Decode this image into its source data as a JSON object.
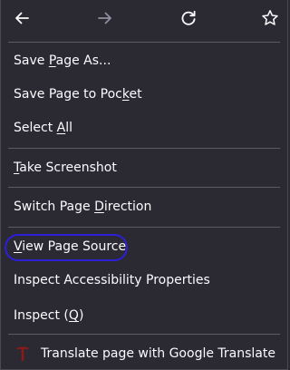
{
  "nav": {
    "back_icon": "arrow-left-icon",
    "forward_icon": "arrow-right-icon",
    "reload_icon": "reload-icon",
    "bookmark_icon": "star-icon",
    "forward_disabled": true
  },
  "menu": {
    "items": [
      {
        "id": "save-page-as",
        "pre": "Save ",
        "key": "P",
        "post": "age As..."
      },
      {
        "id": "save-page-to-pocket",
        "pre": "Save Page to Poc",
        "key": "k",
        "post": "et"
      },
      {
        "id": "select-all",
        "pre": "Select ",
        "key": "A",
        "post": "ll"
      },
      {
        "id": "take-screenshot",
        "pre": "",
        "key": "T",
        "post": "ake Screenshot"
      },
      {
        "id": "switch-page-direction",
        "pre": "Switch Page ",
        "key": "D",
        "post": "irection"
      },
      {
        "id": "view-page-source",
        "pre": "",
        "key": "V",
        "post": "iew Page Source"
      },
      {
        "id": "inspect-accessibility",
        "pre": "Inspect Accessibility Properties",
        "key": "",
        "post": ""
      },
      {
        "id": "inspect",
        "pre": "Inspect (",
        "key": "Q",
        "post": ")"
      },
      {
        "id": "translate-page",
        "pre": "Translate page with Google Translate",
        "key": "",
        "post": ""
      }
    ],
    "extension_icon": "google-translate-t-icon"
  },
  "colors": {
    "background": "#2b2a33",
    "text": "#fbfbfe",
    "separator": "#5b5a66",
    "highlight": "#2d1fd6",
    "extension_icon": "#8b1a1a",
    "disabled_icon": "#8f8f9d"
  }
}
